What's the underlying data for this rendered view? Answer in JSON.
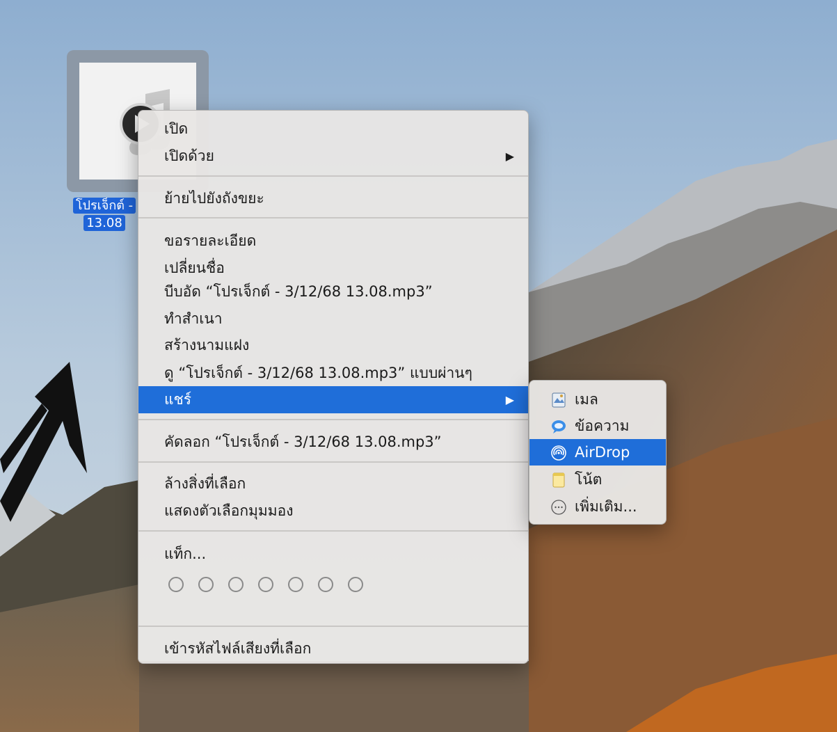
{
  "desktop": {
    "file": {
      "label_line1": "โปรเจ็กต์ -",
      "label_line2": "13.08"
    }
  },
  "context_menu": {
    "items": [
      {
        "label": "เปิด"
      },
      {
        "label": "เปิดด้วย"
      },
      {
        "label": "ย้ายไปยังถังขยะ"
      },
      {
        "label": "ขอรายละเอียด"
      },
      {
        "label": "เปลี่ยนชื่อ"
      },
      {
        "label": "บีบอัด “โปรเจ็กต์ - 3/12/68 13.08.mp3”"
      },
      {
        "label": "ทำสำเนา"
      },
      {
        "label": "สร้างนามแฝง"
      },
      {
        "label": "ดู “โปรเจ็กต์ - 3/12/68 13.08.mp3” แบบผ่านๆ"
      },
      {
        "label": "แชร์"
      },
      {
        "label": "คัดลอก “โปรเจ็กต์ - 3/12/68 13.08.mp3”"
      },
      {
        "label": "ล้างสิ่งที่เลือก"
      },
      {
        "label": "แสดงตัวเลือกมุมมอง"
      },
      {
        "label": "แท็ก..."
      },
      {
        "label": "เข้ารหัสไฟล์เสียงที่เลือก"
      }
    ],
    "submenu_arrow": "▶",
    "tag_count": 7
  },
  "share_submenu": {
    "items": [
      {
        "label": "เมล",
        "icon": "mail-icon"
      },
      {
        "label": "ข้อความ",
        "icon": "messages-icon"
      },
      {
        "label": "AirDrop",
        "icon": "airdrop-icon"
      },
      {
        "label": "โน้ต",
        "icon": "notes-icon"
      },
      {
        "label": "เพิ่มเติม...",
        "icon": "more-icon"
      }
    ]
  },
  "colors": {
    "highlight": "#1f6ed9",
    "selection_label": "#1f64d8"
  }
}
